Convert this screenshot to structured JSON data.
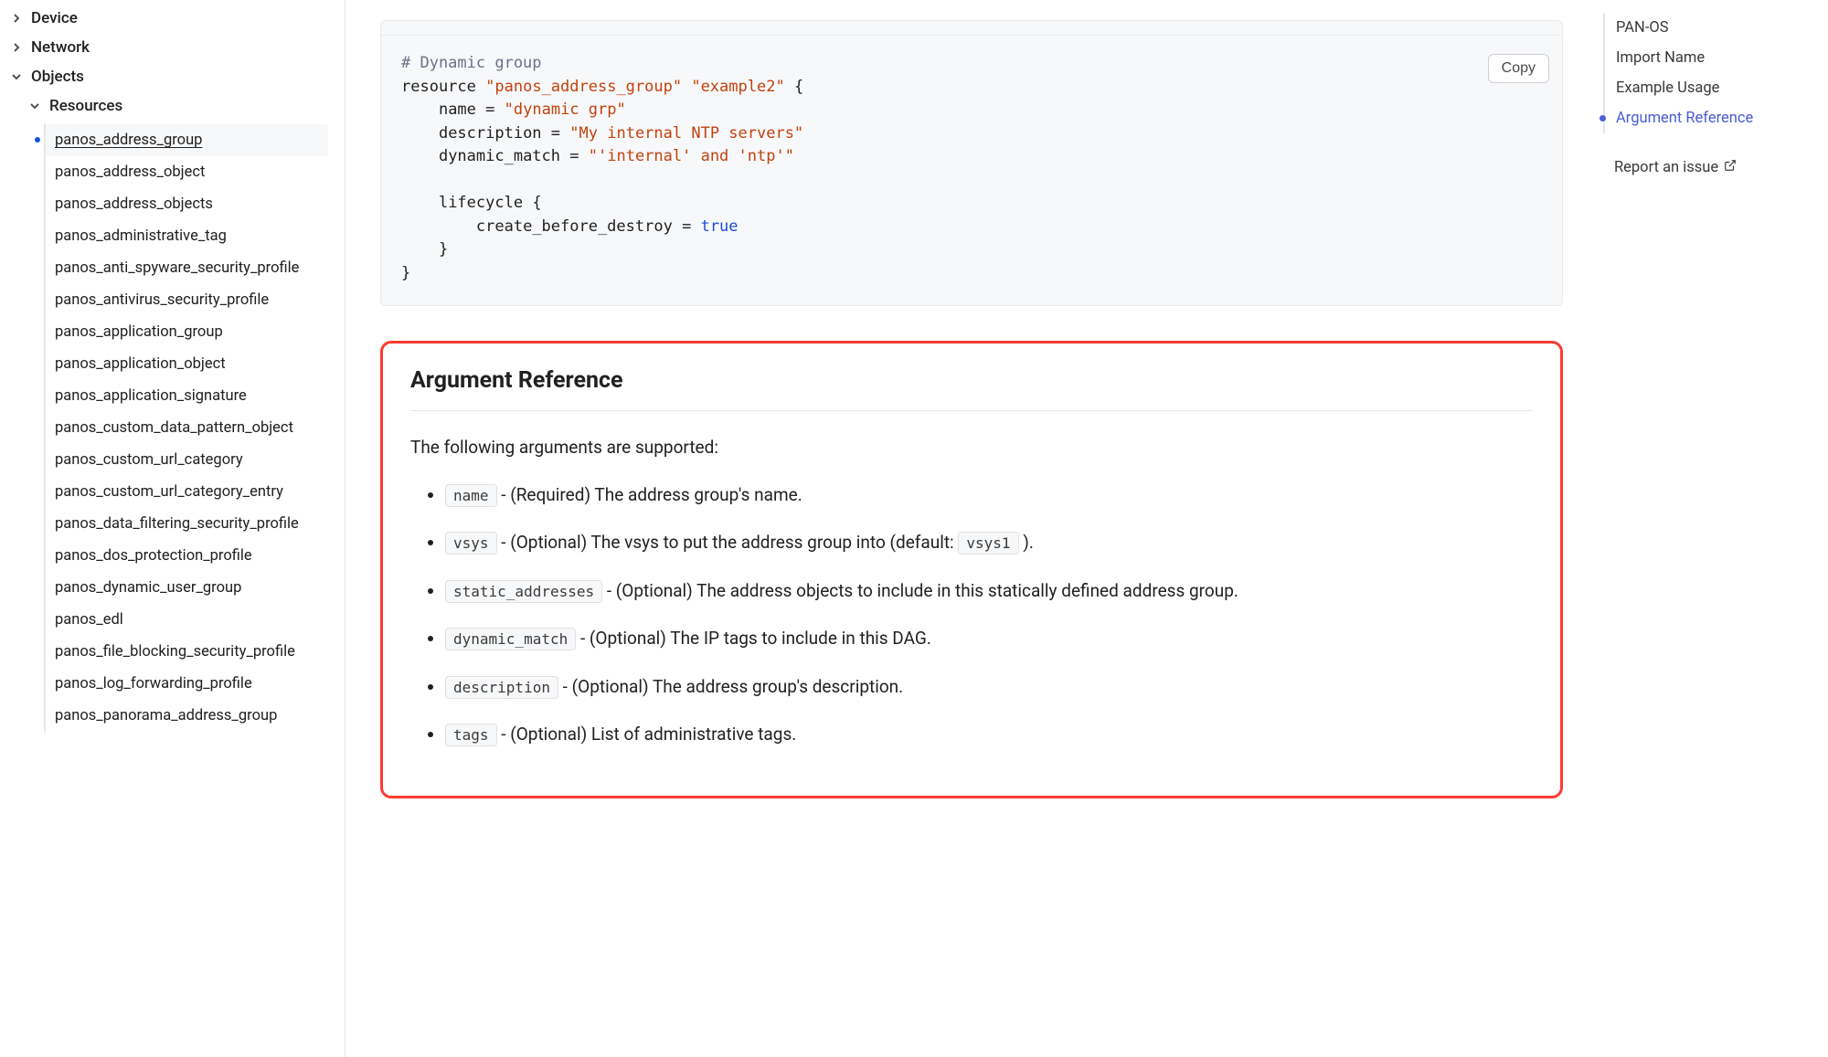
{
  "sidebar": {
    "device": "Device",
    "network": "Network",
    "objects": "Objects",
    "resources": "Resources",
    "items": [
      "panos_address_group",
      "panos_address_object",
      "panos_address_objects",
      "panos_administrative_tag",
      "panos_anti_spyware_security_profile",
      "panos_antivirus_security_profile",
      "panos_application_group",
      "panos_application_object",
      "panos_application_signature",
      "panos_custom_data_pattern_object",
      "panos_custom_url_category",
      "panos_custom_url_category_entry",
      "panos_data_filtering_security_profile",
      "panos_dos_protection_profile",
      "panos_dynamic_user_group",
      "panos_edl",
      "panos_file_blocking_security_profile",
      "panos_log_forwarding_profile",
      "panos_panorama_address_group"
    ]
  },
  "code": {
    "copy": "Copy",
    "comment": "# Dynamic group",
    "kw_resource": "resource",
    "str_type": "\"panos_address_group\"",
    "str_name": "\"example2\"",
    "brace_open": "{",
    "name_k": "name",
    "name_v": "\"dynamic grp\"",
    "desc_k": "description",
    "desc_v": "\"My internal NTP servers\"",
    "dyn_k": "dynamic_match",
    "dyn_v": "\"'internal' and 'ntp'\"",
    "life_k": "lifecycle",
    "create_k": "create_before_destroy",
    "create_v": "true",
    "brace_close": "}",
    "eq": "="
  },
  "argref": {
    "title": "Argument Reference",
    "intro": "The following arguments are supported:",
    "args": [
      {
        "code": "name",
        "desc": " - (Required) The address group's name."
      },
      {
        "code": "vsys",
        "desc_pre": " - (Optional) The vsys to put the address group into (default: ",
        "default": "vsys1",
        "desc_post": " )."
      },
      {
        "code": "static_addresses",
        "desc": " - (Optional) The address objects to include in this statically defined address group."
      },
      {
        "code": "dynamic_match",
        "desc": " - (Optional) The IP tags to include in this DAG."
      },
      {
        "code": "description",
        "desc": " - (Optional) The address group's description."
      },
      {
        "code": "tags",
        "desc": " - (Optional) List of administrative tags."
      }
    ]
  },
  "toc": {
    "items": [
      "PAN-OS",
      "Import Name",
      "Example Usage",
      "Argument Reference"
    ],
    "report": "Report an issue"
  }
}
